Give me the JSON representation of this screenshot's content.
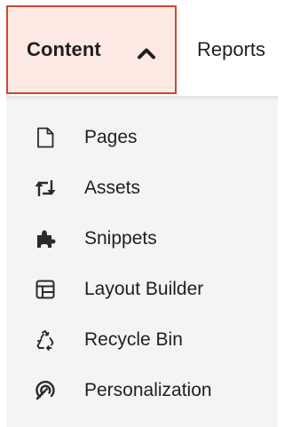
{
  "nav": {
    "tabs": [
      {
        "label": "Content",
        "active": true,
        "expanded": true
      },
      {
        "label": "Reports",
        "active": false
      }
    ],
    "active_border_color": "#d2472c",
    "active_background_color": "#fde8e4"
  },
  "dropdown": {
    "items": [
      {
        "label": "Pages",
        "icon": "page-icon"
      },
      {
        "label": "Assets",
        "icon": "assets-icon"
      },
      {
        "label": "Snippets",
        "icon": "puzzle-piece-icon"
      },
      {
        "label": "Layout Builder",
        "icon": "layout-icon"
      },
      {
        "label": "Recycle Bin",
        "icon": "recycle-icon"
      },
      {
        "label": "Personalization",
        "icon": "personalization-icon"
      }
    ]
  }
}
